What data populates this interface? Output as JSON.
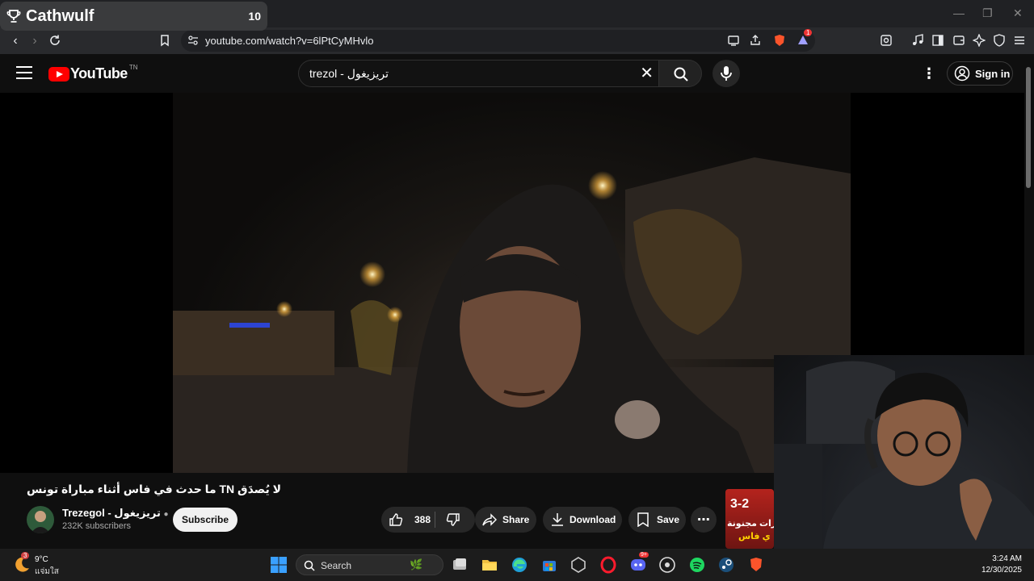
{
  "overlay": {
    "streamer_name": "Cathwulf",
    "count": "10"
  },
  "browser": {
    "url": "youtube.com/watch?v=6lPtCyMHvlo",
    "extension_badge": "1"
  },
  "youtube": {
    "logo_text": "YouTube",
    "region": "TN",
    "search_query": "trezol - تريزيغول",
    "signin_label": "Sign in"
  },
  "video": {
    "title": "لا يُصدَق TN ما حدث في فاس أثناء مباراة تونس",
    "channel_name": "Trezegol - تريزيغول",
    "subscribers": "232K subscribers",
    "subscribe_label": "Subscribe",
    "likes": "388",
    "share_label": "Share",
    "download_label": "Download",
    "save_label": "Save"
  },
  "next_thumbnail": {
    "score": "3-2",
    "text_line1": "رات مجنونة",
    "text_line2": "ي فاس"
  },
  "taskbar": {
    "weather_temp": "9°C",
    "weather_condition": "แจ่มใส",
    "weather_badge": "3",
    "search_label": "Search",
    "discord_badge": "9+",
    "clock_time": "3:24 AM",
    "clock_date": "12/30/2025"
  }
}
